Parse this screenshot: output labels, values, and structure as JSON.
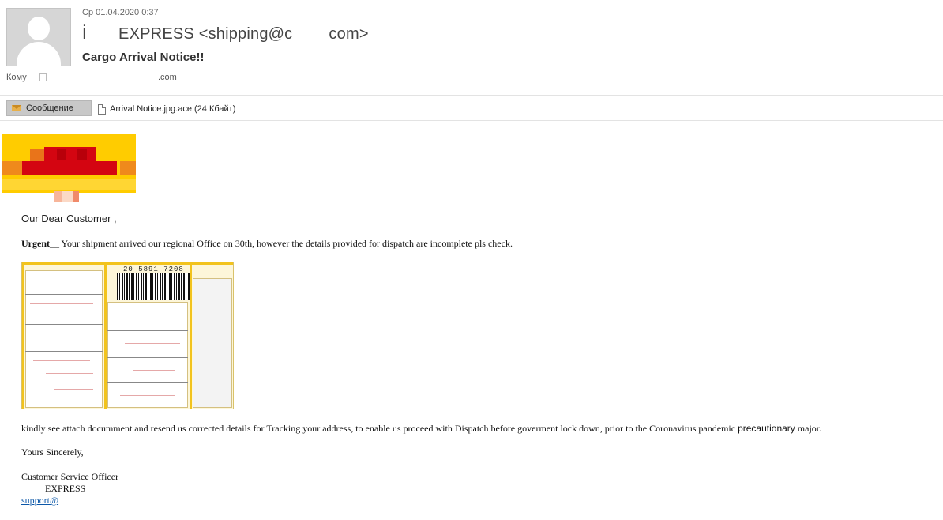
{
  "header": {
    "date": "Ср 01.04.2020 0:37",
    "from": "İ       EXPRESS <shipping@c        com>",
    "subject": "Cargo Arrival Notice!!",
    "to_label": "Кому",
    "to_address": ".com"
  },
  "tabs": {
    "message_label": "Сообщение",
    "attachment_label": "Arrival Notice.jpg.ace (24 Кбайт)"
  },
  "body": {
    "greeting": "Our Dear Customer ,",
    "urgent_label": "Urgent__",
    "urgent_text": " Your shipment arrived our regional Office on 30th, however the details provided for dispatch are incomplete pls check.",
    "waybill_number": "20 5891 7208",
    "main_text": "kindly see attach documment and resend us corrected details for Tracking your address, to enable us proceed with Dispatch before goverment lock down, prior to the Coronavirus pandemic ",
    "main_word_alt": "precautionary",
    "main_tail": " major.",
    "closing": "Yours Sincerely,",
    "signature_title": "Customer Service Officer",
    "signature_brand": "EXPRESS",
    "signature_email": "support@"
  },
  "colors": {
    "logo_yellow": "#ffcc00",
    "logo_red": "#d40511",
    "link_blue": "#0b57a8"
  }
}
